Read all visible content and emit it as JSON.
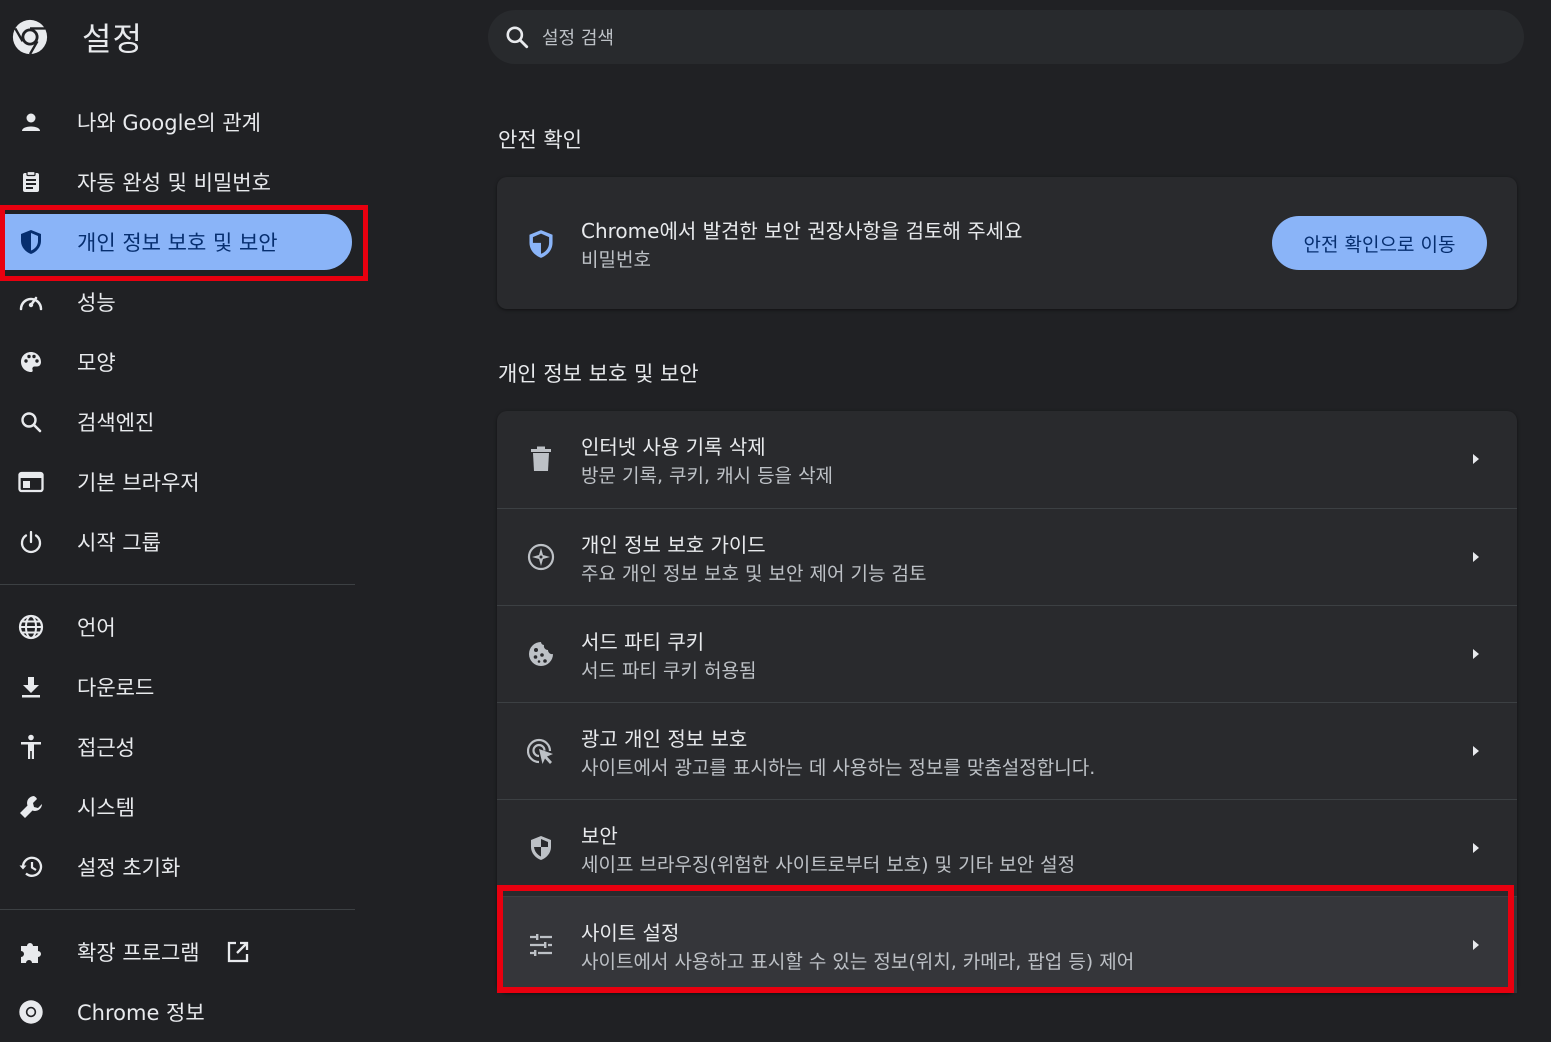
{
  "app": {
    "title": "설정"
  },
  "search": {
    "placeholder": "설정 검색"
  },
  "nav": {
    "items": [
      {
        "id": "you-and-google",
        "label": "나와 Google의 관계",
        "icon": "person-icon"
      },
      {
        "id": "autofill",
        "label": "자동 완성 및 비밀번호",
        "icon": "clipboard-icon"
      },
      {
        "id": "privacy",
        "label": "개인 정보 보호 및 보안",
        "icon": "shield-icon",
        "active": true
      },
      {
        "id": "performance",
        "label": "성능",
        "icon": "speedometer-icon"
      },
      {
        "id": "appearance",
        "label": "모양",
        "icon": "palette-icon"
      },
      {
        "id": "search-engine",
        "label": "검색엔진",
        "icon": "search-icon"
      },
      {
        "id": "default-browser",
        "label": "기본 브라우저",
        "icon": "browser-window-icon"
      },
      {
        "id": "on-startup",
        "label": "시작 그룹",
        "icon": "power-icon"
      },
      {
        "id": "languages",
        "label": "언어",
        "icon": "globe-icon"
      },
      {
        "id": "downloads",
        "label": "다운로드",
        "icon": "download-icon"
      },
      {
        "id": "accessibility",
        "label": "접근성",
        "icon": "accessibility-icon"
      },
      {
        "id": "system",
        "label": "시스템",
        "icon": "wrench-icon"
      },
      {
        "id": "reset",
        "label": "설정 초기화",
        "icon": "history-icon"
      },
      {
        "id": "extensions",
        "label": "확장 프로그램",
        "icon": "puzzle-icon"
      },
      {
        "id": "about",
        "label": "Chrome 정보",
        "icon": "chrome-icon"
      }
    ]
  },
  "safety_check": {
    "heading": "안전 확인",
    "title": "Chrome에서 발견한 보안 권장사항을 검토해 주세요",
    "subtitle": "비밀번호",
    "button": "안전 확인으로 이동"
  },
  "privacy": {
    "heading": "개인 정보 보호 및 보안",
    "rows": [
      {
        "title": "인터넷 사용 기록 삭제",
        "subtitle": "방문 기록, 쿠키, 캐시 등을 삭제",
        "icon": "trash-icon"
      },
      {
        "title": "개인 정보 보호 가이드",
        "subtitle": "주요 개인 정보 보호 및 보안 제어 기능 검토",
        "icon": "compass-icon"
      },
      {
        "title": "서드 파티 쿠키",
        "subtitle": "서드 파티 쿠키 허용됨",
        "icon": "cookie-icon"
      },
      {
        "title": "광고 개인 정보 보호",
        "subtitle": "사이트에서 광고를 표시하는 데 사용하는 정보를 맞춤설정합니다.",
        "icon": "ad-privacy-icon"
      },
      {
        "title": "보안",
        "subtitle": "세이프 브라우징(위험한 사이트로부터 보호) 및 기타 보안 설정",
        "icon": "shield-icon"
      },
      {
        "title": "사이트 설정",
        "subtitle": "사이트에서 사용하고 표시할 수 있는 정보(위치, 카메라, 팝업 등) 제어",
        "icon": "sliders-icon"
      }
    ]
  },
  "colors": {
    "accent": "#8ab4f8",
    "highlight": "#e8000f",
    "background": "#202124",
    "card": "#292a2d"
  }
}
